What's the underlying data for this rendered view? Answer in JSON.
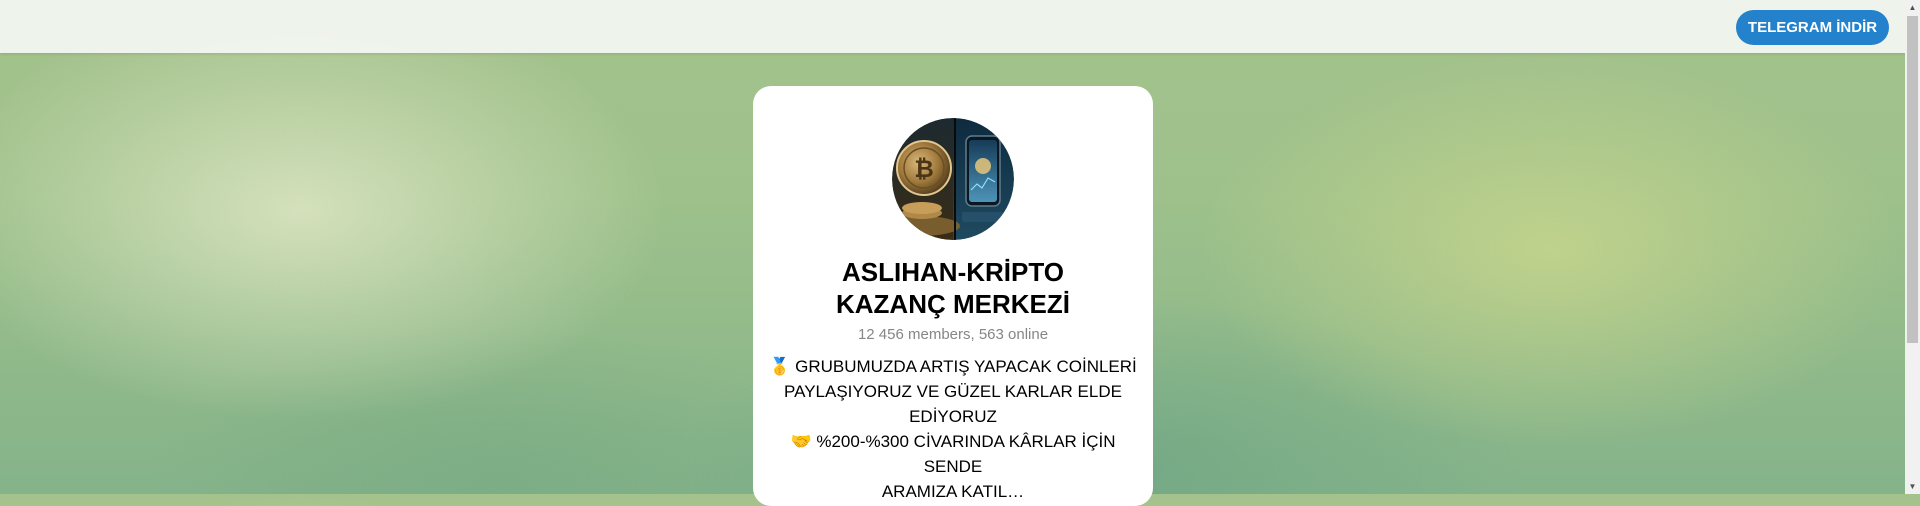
{
  "header": {
    "download_button_label": "TELEGRAM İNDİR",
    "accent_color": "#2481cc"
  },
  "channel": {
    "title_lines": [
      "ASLIHAN-KRİPTO",
      "KAZANÇ MERKEZİ"
    ],
    "members_text": "12 456 members, 563 online",
    "description_lines": [
      "🥇 GRUBUMUZDA ARTIŞ YAPACAK COİNLERİ",
      "PAYLAŞIYORUZ VE GÜZEL KARLAR ELDE",
      "EDİYORUZ",
      "🤝 %200-%300 CİVARINDA KÂRLAR İÇİN SENDE",
      "ARAMIZA KATIL…"
    ],
    "avatar_icon": "bitcoin-coin-and-phone-image"
  },
  "scrollbar": {
    "up_icon": "scroll-up-arrow",
    "down_icon": "scroll-down-arrow"
  }
}
